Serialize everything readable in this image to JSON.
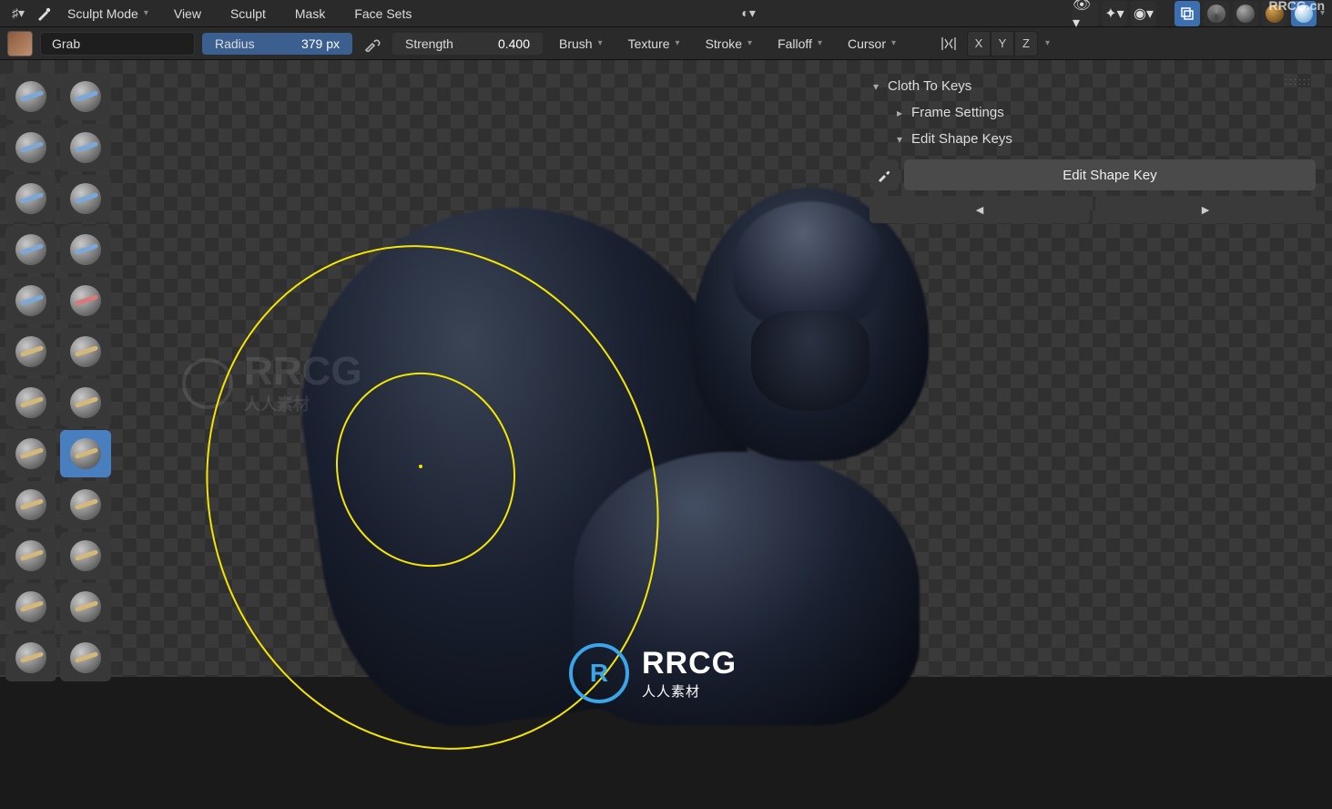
{
  "header": {
    "mode": "Sculpt Mode",
    "menus": [
      "View",
      "Sculpt",
      "Mask",
      "Face Sets"
    ]
  },
  "props": {
    "brush_name": "Grab",
    "radius_label": "Radius",
    "radius_value": "379 px",
    "strength_label": "Strength",
    "strength_value": "0.400",
    "dropdowns": [
      "Brush",
      "Texture",
      "Stroke",
      "Falloff",
      "Cursor"
    ],
    "axes": [
      "X",
      "Y",
      "Z"
    ]
  },
  "tool_icons": [
    {
      "name": "draw-tool",
      "stroke": "stroke-blue"
    },
    {
      "name": "draw-sharp-tool",
      "stroke": "stroke-blue"
    },
    {
      "name": "clay-tool",
      "stroke": "stroke-blue"
    },
    {
      "name": "clay-strips-tool",
      "stroke": "stroke-blue"
    },
    {
      "name": "clay-thumb-tool",
      "stroke": "stroke-blue"
    },
    {
      "name": "layer-tool",
      "stroke": "stroke-blue"
    },
    {
      "name": "inflate-tool",
      "stroke": "stroke-blue"
    },
    {
      "name": "blob-tool",
      "stroke": "stroke-blue"
    },
    {
      "name": "crease-tool",
      "stroke": "stroke-blue"
    },
    {
      "name": "smooth-tool",
      "stroke": "stroke-red"
    },
    {
      "name": "flatten-tool",
      "stroke": "stroke-tan"
    },
    {
      "name": "fill-tool",
      "stroke": "stroke-tan"
    },
    {
      "name": "scrape-tool",
      "stroke": "stroke-tan"
    },
    {
      "name": "multiplane-tool",
      "stroke": "stroke-tan"
    },
    {
      "name": "pinch-tool",
      "stroke": "stroke-tan"
    },
    {
      "name": "grab-tool",
      "stroke": "stroke-tan",
      "active": true
    },
    {
      "name": "elastic-tool",
      "stroke": "stroke-tan"
    },
    {
      "name": "snake-hook-tool",
      "stroke": "stroke-tan"
    },
    {
      "name": "thumb-tool",
      "stroke": "stroke-tan"
    },
    {
      "name": "pose-tool",
      "stroke": "stroke-tan"
    },
    {
      "name": "nudge-tool",
      "stroke": "stroke-tan"
    },
    {
      "name": "rotate-tool",
      "stroke": "stroke-tan"
    },
    {
      "name": "slide-tool",
      "stroke": "stroke-tan"
    },
    {
      "name": "boundary-tool",
      "stroke": "stroke-tan"
    }
  ],
  "panel": {
    "section1": "Cloth To Keys",
    "section2": "Frame Settings",
    "section3": "Edit Shape Keys",
    "action_btn": "Edit Shape Key",
    "prev": "◄",
    "next": "►"
  },
  "watermark": {
    "main": "RRCG",
    "sub": "人人素材",
    "url": "RRCG.cn"
  }
}
